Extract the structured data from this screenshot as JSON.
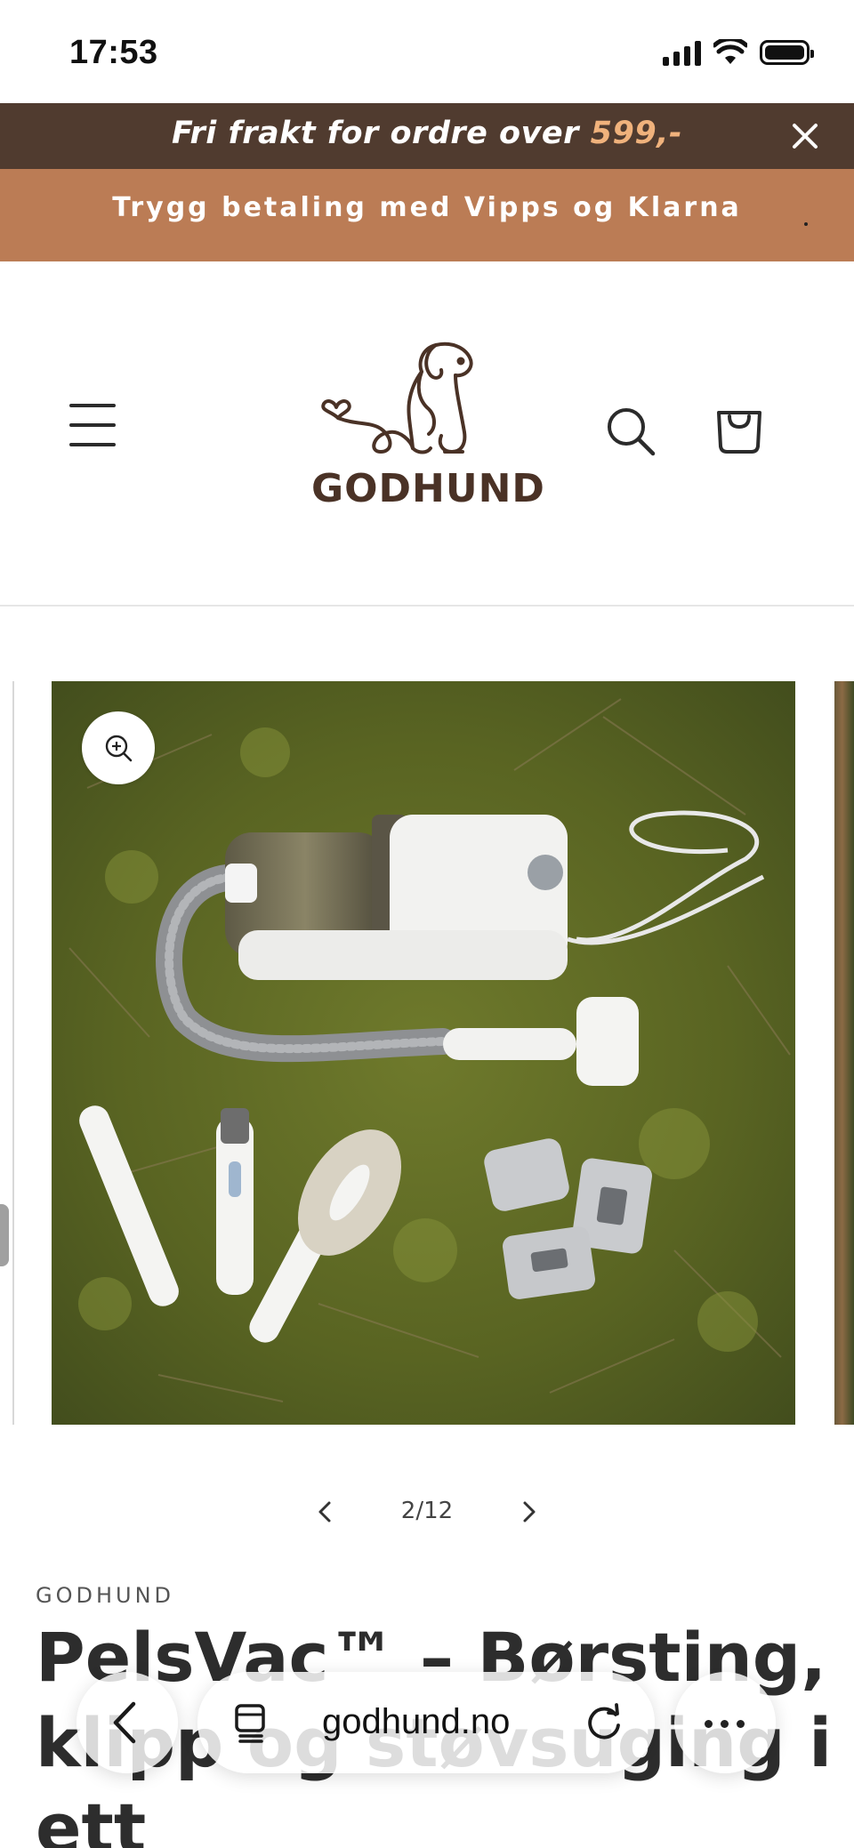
{
  "status_bar": {
    "time": "17:53",
    "icons": [
      "cellular-signal-icon",
      "wifi-icon",
      "battery-icon"
    ]
  },
  "announcements": {
    "shipping_prefix": "Fri frakt for ordre over ",
    "shipping_amount": "599,-",
    "payment": "Trygg betaling med Vipps og Klarna",
    "colors": {
      "top_bar": "#503b2f",
      "accent": "#f0b27c",
      "second_bar": "#bb7c55"
    }
  },
  "header": {
    "logo_text": "GODHUND",
    "icons": [
      "menu-icon",
      "dog-logo",
      "search-icon",
      "cart-icon"
    ]
  },
  "gallery": {
    "current": "2/12",
    "image_alt": "Pet grooming vacuum kit with attachments on moss"
  },
  "product": {
    "vendor": "GODHUND",
    "title_lines": [
      "PelsVac™ – Børsting,",
      "klipp og støvsuging i",
      "ett"
    ]
  },
  "browser": {
    "url": "godhund.no",
    "icons": [
      "back-chevron-icon",
      "tabs-icon",
      "reload-icon",
      "more-icon"
    ]
  }
}
